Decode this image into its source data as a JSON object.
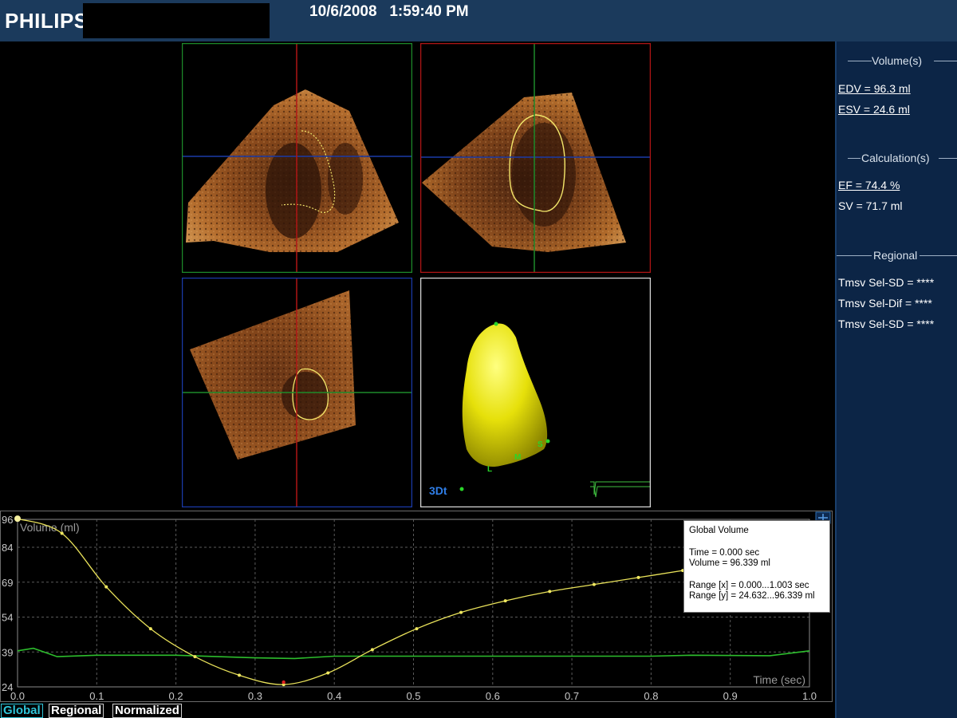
{
  "header": {
    "logo": "PHILIPS",
    "datetime": "10/6/2008   1:59:40 PM"
  },
  "right_panel": {
    "volumes": {
      "title": "Volume(s)",
      "items": [
        "EDV = 96.3 ml",
        "ESV = 24.6 ml"
      ]
    },
    "calculations": {
      "title": "Calculation(s)",
      "items": [
        "EF = 74.4 %",
        "SV = 71.7 ml"
      ]
    },
    "regional": {
      "title": "Regional",
      "items": [
        "Tmsv Sel-SD = ****",
        "Tmsv Sel-Dif = ****",
        "Tmsv Sel-SD = ****"
      ]
    }
  },
  "viewports": {
    "model_label": "3Dt",
    "model_markers": [
      "S",
      "L",
      "M"
    ]
  },
  "graph": {
    "ylabel": "Volume (ml)",
    "xlabel": "Time (sec)",
    "y_ticks": [
      "96",
      "84",
      "69",
      "54",
      "39",
      "24"
    ],
    "x_ticks": [
      "0.0",
      "0.1",
      "0.2",
      "0.3",
      "0.4",
      "0.5",
      "0.6",
      "0.7",
      "0.8",
      "0.9",
      "1.0"
    ],
    "tooltip": {
      "title": "Global Volume",
      "time": "Time = 0.000 sec",
      "volume": "Volume = 96.339 ml",
      "range_x": "Range [x] = 0.000...1.003 sec",
      "range_y": "Range [y] = 24.632...96.339 ml"
    }
  },
  "chart_data": {
    "type": "line",
    "xlabel": "Time (sec)",
    "ylabel": "Volume (ml)",
    "xlim": [
      0.0,
      1.0
    ],
    "ylim": [
      24,
      96
    ],
    "series": [
      {
        "x": [
          0.0,
          0.056,
          0.112,
          0.168,
          0.224,
          0.28,
          0.336,
          0.392,
          0.448,
          0.504,
          0.56,
          0.616,
          0.672,
          0.728,
          0.784,
          0.84
        ],
        "y": [
          96.3,
          90,
          67,
          49,
          37,
          29,
          25,
          30,
          40,
          49,
          56,
          61,
          65,
          68,
          71,
          74
        ]
      },
      {
        "x": [
          0.0,
          0.02,
          0.05,
          0.1,
          0.2,
          0.3,
          0.35,
          0.4,
          0.5,
          0.6,
          0.7,
          0.8,
          0.85,
          0.95,
          1.0
        ],
        "y": [
          39.5,
          40.6,
          37.0,
          37.6,
          37.6,
          36.5,
          36.2,
          37.2,
          37.2,
          37.2,
          37.2,
          37.2,
          37.6,
          37.4,
          39.5
        ]
      }
    ]
  },
  "tabs": [
    "Global",
    "Regional",
    "Normalized"
  ]
}
